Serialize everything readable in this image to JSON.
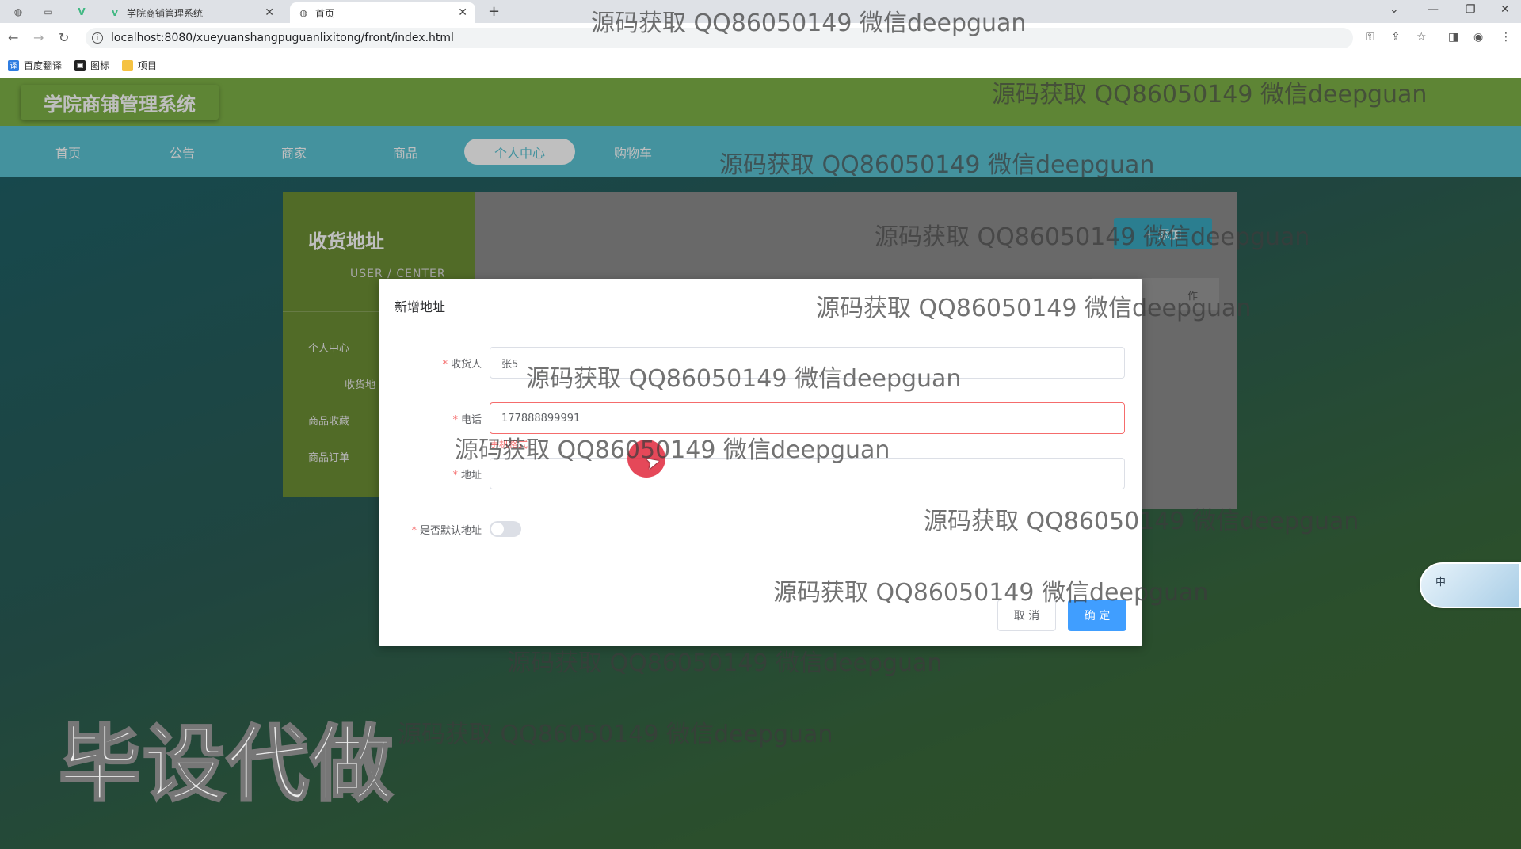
{
  "browser": {
    "tabs": [
      {
        "title": "学院商铺管理系统",
        "active": false
      },
      {
        "title": "首页",
        "active": true
      }
    ],
    "url": "localhost:8080/xueyuanshangpuguanlixitong/front/index.html",
    "bookmarks": [
      "百度翻译",
      "图标",
      "项目"
    ]
  },
  "site": {
    "logo": "学院商铺管理系统",
    "nav": [
      "首页",
      "公告",
      "商家",
      "商品",
      "个人中心",
      "购物车"
    ],
    "active_nav": "个人中心"
  },
  "side_panel": {
    "title": "收货地址",
    "subtitle": "USER / CENTER",
    "items": [
      "个人中心",
      "收货地",
      "商品收藏",
      "商品订单"
    ]
  },
  "main_panel": {
    "add_button": "+ 添加",
    "column_header": "作"
  },
  "dialog": {
    "title": "新增地址",
    "fields": {
      "consignee": {
        "label": "收货人",
        "value": "张5"
      },
      "phone": {
        "label": "电话",
        "value": "177888899991",
        "error": "手机格式"
      },
      "address": {
        "label": "地址",
        "value": ""
      },
      "default": {
        "label": "是否默认地址",
        "checked": false
      }
    },
    "cancel": "取 消",
    "confirm": "确 定"
  },
  "widget": {
    "text": "中"
  },
  "watermarks": {
    "text": "源码获取 QQ86050149 微信deepguan",
    "big": "毕设代做"
  },
  "colors": {
    "header_green": "#7eb247",
    "nav_cyan": "#5bc3d3",
    "primary_blue": "#409eff",
    "error_red": "#f56c6c"
  }
}
